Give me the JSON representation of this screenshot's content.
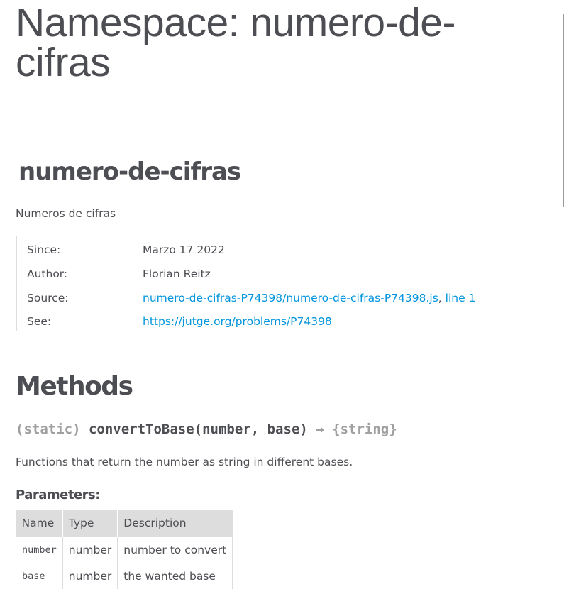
{
  "page": {
    "title": "Namespace: numero-de-\ncifras"
  },
  "namespace": {
    "name": "numero-de-cifras",
    "description": "Numeros de cifras",
    "details": {
      "since_label": "Since:",
      "since_value": "Marzo 17 2022",
      "author_label": "Author:",
      "author_value": "Florian Reitz",
      "source_label": "Source:",
      "source_file": "numero-de-cifras-P74398/numero-de-cifras-P74398.js",
      "source_separator": ", ",
      "source_line": "line 1",
      "see_label": "See:",
      "see_link": "https://jutge.org/problems/P74398"
    }
  },
  "methods": {
    "section_title": "Methods",
    "items": [
      {
        "attribs": "(static) ",
        "name": "convertToBase",
        "signature": "(number, base)",
        "arrow": " → ",
        "returns": "{string}",
        "description": "Functions that return the number as string in different bases.",
        "params_title": "Parameters:",
        "params_headers": [
          "Name",
          "Type",
          "Description"
        ],
        "params": [
          {
            "name": "number",
            "type": "number",
            "description": "number to convert"
          },
          {
            "name": "base",
            "type": "number",
            "description": "the wanted base"
          }
        ]
      }
    ]
  },
  "colors": {
    "text": "#4d4e53",
    "link": "#0095dd",
    "muted": "#a0a0a0",
    "table_header_bg": "#dddddd"
  }
}
